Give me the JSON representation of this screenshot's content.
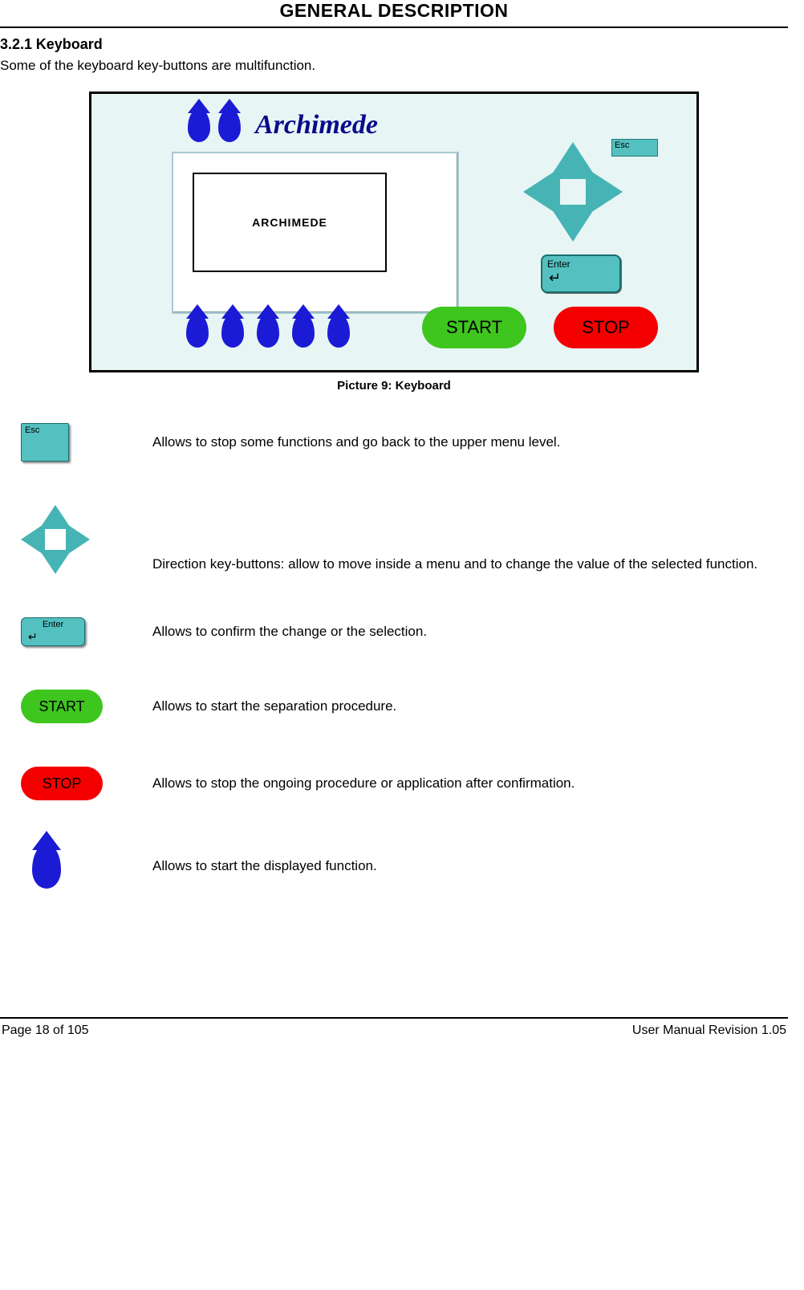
{
  "header": {
    "title": "GENERAL DESCRIPTION"
  },
  "section": {
    "number": "3.2.1",
    "title": "Keyboard"
  },
  "intro": "Some of the keyboard key-buttons are multifunction.",
  "keyboard": {
    "logo_text": "Archimede",
    "screen_label": "ARCHIMEDE",
    "esc_label": "Esc",
    "enter_label": "Enter",
    "start_label": "START",
    "stop_label": "STOP"
  },
  "caption": "Picture 9: Keyboard",
  "descriptions": {
    "esc": "Allows to stop some functions and go back to the upper menu level.",
    "arrows": "Direction key-buttons: allow to move inside a menu and to change the value of the selected function.",
    "enter": "Allows to confirm the change or the selection.",
    "start": "Allows to start the separation procedure.",
    "stop": "Allows to stop the ongoing procedure or application after confirmation.",
    "drop": "Allows to start the displayed function."
  },
  "labels": {
    "esc": "Esc",
    "enter": "Enter",
    "start": "START",
    "stop": "STOP"
  },
  "footer": {
    "page": "Page 18 of 105",
    "revision": "User Manual Revision 1.05"
  }
}
